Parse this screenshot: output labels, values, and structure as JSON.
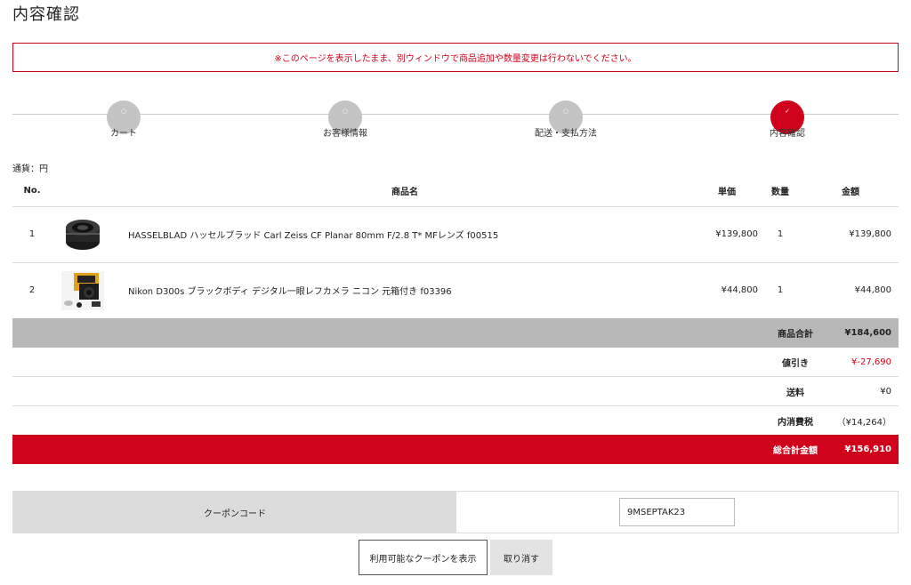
{
  "page": {
    "title": "内容確認",
    "notice": "※このページを表示したまま、別ウィンドウで商品追加や数量変更は行わないでください。"
  },
  "steps": [
    {
      "label": "カート",
      "active": false
    },
    {
      "label": "お客様情報",
      "active": false
    },
    {
      "label": "配送・支払方法",
      "active": false
    },
    {
      "label": "内容確認",
      "active": true
    }
  ],
  "currency_label": "通貨：円",
  "table": {
    "headers": {
      "no": "No.",
      "name": "商品名",
      "price": "単価",
      "qty": "数量",
      "total": "金額"
    },
    "rows": [
      {
        "no": "1",
        "name": "HASSELBLAD ハッセルブラッド Carl Zeiss CF Planar 80mm F/2.8 T* MFレンズ f00515",
        "price": "¥139,800",
        "qty": "1",
        "total": "¥139,800"
      },
      {
        "no": "2",
        "name": "Nikon D300s ブラックボディ デジタル一眼レフカメラ ニコン 元箱付き f03396",
        "price": "¥44,800",
        "qty": "1",
        "total": "¥44,800"
      }
    ]
  },
  "summary": {
    "subtotal": {
      "label": "商品合計",
      "value": "¥184,600"
    },
    "discount": {
      "label": "値引き",
      "value": "¥-27,690"
    },
    "shipping": {
      "label": "送料",
      "value": "¥0"
    },
    "tax": {
      "label": "内消費税",
      "value": "（¥14,264）"
    },
    "grand_total": {
      "label": "総合計金額",
      "value": "¥156,910"
    }
  },
  "coupon": {
    "label": "クーポンコード",
    "value": "9MSEPTAK23",
    "show_button": "利用可能なクーポンを表示",
    "cancel_button": "取り消す"
  },
  "colors": {
    "accent": "#d0021b",
    "gray_bar": "#b7b7b7",
    "step_inactive": "#c4c4c4"
  }
}
